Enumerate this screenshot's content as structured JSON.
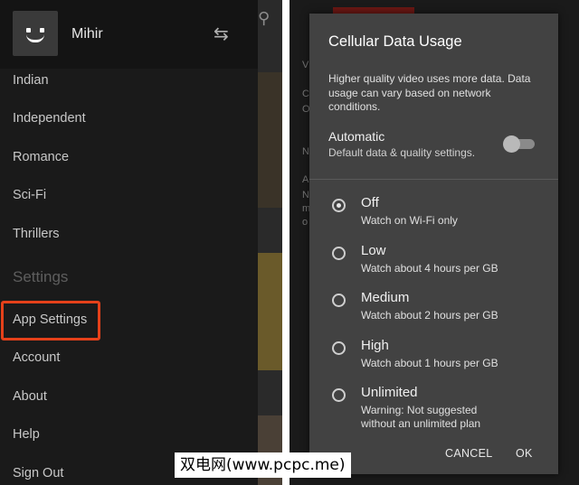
{
  "left_panel": {
    "search_icon": "search-icon",
    "profile": {
      "name": "Mihir",
      "switch_icon": "swap-arrows-icon"
    },
    "genres": [
      "Indian",
      "Independent",
      "Romance",
      "Sci-Fi",
      "Thrillers"
    ],
    "settings_heading": "Settings",
    "settings_items": [
      "App Settings",
      "Account",
      "About",
      "Help",
      "Sign Out"
    ],
    "highlight_color": "#e5411a"
  },
  "right_panel": {
    "background_letters": [
      "V",
      "C",
      "O",
      "N",
      "A",
      "N",
      "m",
      "o"
    ],
    "dialog": {
      "title": "Cellular Data Usage",
      "description": "Higher quality video uses more data. Data usage can vary based on network conditions.",
      "automatic": {
        "label": "Automatic",
        "sublabel": "Default data & quality settings.",
        "enabled": false
      },
      "options": [
        {
          "label": "Off",
          "description": "Watch on Wi-Fi only",
          "selected": true
        },
        {
          "label": "Low",
          "description": "Watch about 4 hours per GB",
          "selected": false
        },
        {
          "label": "Medium",
          "description": "Watch about 2 hours per GB",
          "selected": false
        },
        {
          "label": "High",
          "description": "Watch about 1 hours per GB",
          "selected": false
        },
        {
          "label": "Unlimited",
          "description": "Warning: Not suggested without an unlimited plan",
          "selected": false
        }
      ],
      "cancel_label": "CANCEL",
      "ok_label": "OK"
    }
  },
  "watermark": "双电网(www.pcpc.me)"
}
